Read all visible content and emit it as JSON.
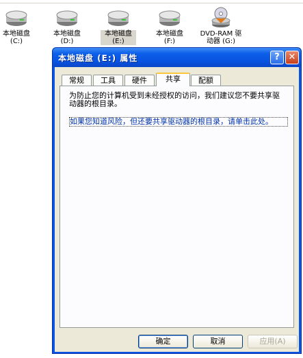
{
  "explorer": {
    "drives": [
      {
        "name": "本地磁盘",
        "letter": "(C:)",
        "type": "hdd",
        "selected": false
      },
      {
        "name": "本地磁盘",
        "letter": "(D:)",
        "type": "hdd",
        "selected": false
      },
      {
        "name": "本地磁盘",
        "letter": "(E:)",
        "type": "hdd",
        "selected": true
      },
      {
        "name": "本地磁盘",
        "letter": "(F:)",
        "type": "hdd",
        "selected": false
      },
      {
        "name": "DVD-RAM 驱",
        "letter": "动器 (G:)",
        "type": "dvd",
        "selected": false
      }
    ]
  },
  "dialog": {
    "title": "本地磁盘 (E:) 属性",
    "help_icon": "?",
    "close_icon": "✕",
    "tabs": [
      {
        "label": "常规"
      },
      {
        "label": "工具"
      },
      {
        "label": "硬件"
      },
      {
        "label": "共享",
        "active": true
      },
      {
        "label": "配额"
      }
    ],
    "share": {
      "notice": "为防止您的计算机受到未经授权的访问，我们建议您不要共享驱动器的根目录。",
      "link": "如果您知道风险，但还要共享驱动器的根目录，请单击此处。"
    },
    "buttons": {
      "ok": "确定",
      "cancel": "取消",
      "apply": "应用(A)"
    }
  },
  "colors": {
    "title_bar": "#0a54e3",
    "dialog_face": "#ece9d8",
    "link": "#0033aa",
    "active_tab_accent": "#ffc73c"
  }
}
